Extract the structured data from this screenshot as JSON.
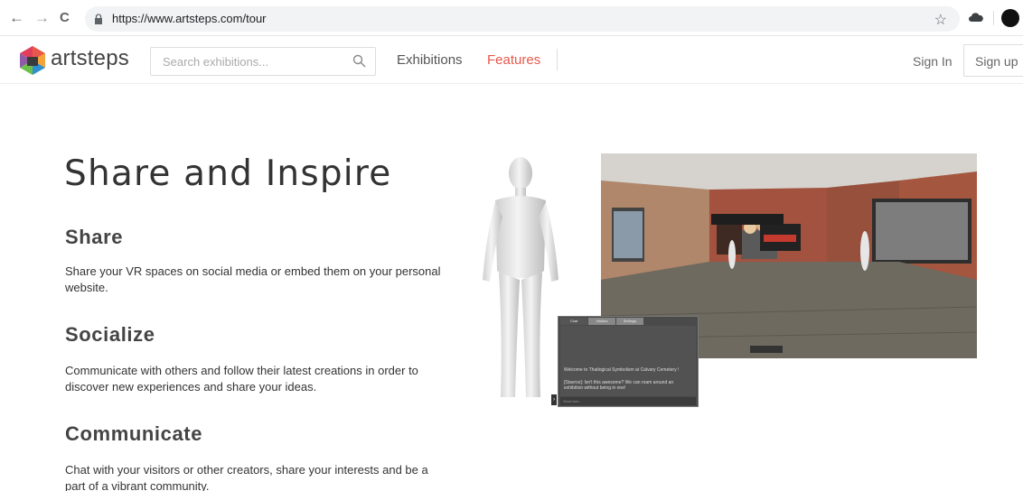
{
  "browser": {
    "url": "https://www.artsteps.com/tour",
    "back_icon": "←",
    "forward_icon": "→",
    "reload_icon": "C",
    "star_icon": "☆"
  },
  "header": {
    "logo_text": "artsteps",
    "search_placeholder": "Search exhibitions...",
    "nav": {
      "exhibitions": "Exhibitions",
      "features": "Features"
    },
    "sign_in": "Sign In",
    "sign_up": "Sign up",
    "accent_color": "#e8584a"
  },
  "main": {
    "title": "Share and Inspire",
    "sections": [
      {
        "heading": "Share",
        "body": "Share your VR spaces on social media or embed them on your personal website."
      },
      {
        "heading": "Socialize",
        "body": "Communicate with others and follow their latest creations in order to discover new experiences and share your ideas."
      },
      {
        "heading": "Communicate",
        "body": "Chat with your visitors or other creators, share your interests and be a part of a vibrant community."
      }
    ]
  },
  "illustration": {
    "chat_tabs": [
      "Chat",
      "Visitors",
      "Settings"
    ],
    "chat_messages": [
      "Welcome to Thatlogical Symbolism at Calvary Cemetery !",
      "[Stavros]: Isn't this awesome? We can roam around an exhibition without being in one!"
    ],
    "chat_input_placeholder": "Send text...",
    "speech_bubble": "Isn't this awesome? We can roam around an exhibition without being in one!"
  }
}
